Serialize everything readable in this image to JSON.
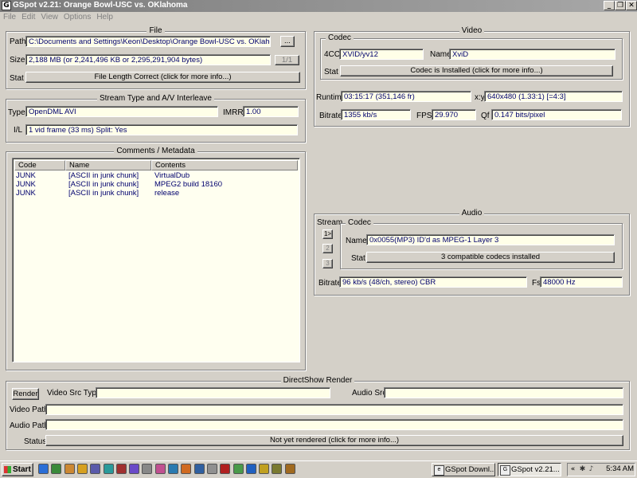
{
  "window": {
    "title": "GSpot v2.21: Orange Bowl-USC vs. OKlahoma",
    "buttons": {
      "minimize": "_",
      "restore": "❐",
      "close": "✕"
    }
  },
  "menu": [
    "File",
    "Edit",
    "View",
    "Options",
    "Help"
  ],
  "file": {
    "group_title": "File",
    "path_label": "Path",
    "path_value": "C:\\Documents and Settings\\Keon\\Desktop\\Orange Bowl-USC vs. OKlahoma.avi",
    "browse_label": "...",
    "size_label": "Size",
    "size_value": "2,188 MB (or 2,241,496 KB or 2,295,291,904 bytes)",
    "page_label": "1/1",
    "stat_label": "Stat",
    "stat_value": "File Length Correct (click for more info...)"
  },
  "stream": {
    "group_title": "Stream Type and A/V Interleave",
    "type_label": "Type",
    "type_value": "OpenDML AVI",
    "imrr_label": "IMRR",
    "imrr_value": "1.00",
    "il_label": "I/L",
    "il_value": "1 vid frame (33 ms)  Split: Yes"
  },
  "meta": {
    "group_title": "Comments / Metadata",
    "columns": [
      "Code",
      "Name",
      "Contents"
    ],
    "rows": [
      {
        "code": "JUNK",
        "name": "[ASCII in junk chunk]",
        "contents": "VirtualDub"
      },
      {
        "code": "JUNK",
        "name": "[ASCII in junk chunk]",
        "contents": "MPEG2 build 18160"
      },
      {
        "code": "JUNK",
        "name": "[ASCII in junk chunk]",
        "contents": "release"
      }
    ]
  },
  "video": {
    "group_title": "Video",
    "codec_title": "Codec",
    "fourcc_label": "4CC",
    "fourcc_value": "XVID/yv12",
    "name_label": "Name",
    "name_value": "XviD",
    "stat_label": "Stat",
    "stat_value": "Codec is Installed (click for more info...)",
    "runtime_label": "Runtime",
    "runtime_value": "03:15:17 (351,146 fr)",
    "xy_label": "x:y",
    "xy_value": "640x480 (1.33:1) [=4:3]",
    "bitrate_label": "Bitrate",
    "bitrate_value": "1355 kb/s",
    "fps_label": "FPS",
    "fps_value": "29.970",
    "qf_label": "Qf",
    "qf_value": "0.147 bits/pixel"
  },
  "audio": {
    "group_title": "Audio",
    "stream_label": "Stream",
    "stream_buttons": [
      "1>",
      "2",
      "3"
    ],
    "codec_title": "Codec",
    "name_label": "Name",
    "name_value": "0x0055(MP3) ID'd as MPEG-1 Layer 3",
    "stat_label": "Stat",
    "stat_value": "3 compatible codecs installed",
    "bitrate_label": "Bitrate",
    "bitrate_value": "96 kb/s (48/ch, stereo) CBR",
    "fs_label": "Fs",
    "fs_value": "48000 Hz"
  },
  "render": {
    "group_title": "DirectShow Render",
    "render_button": "Render",
    "video_src_type_label": "Video Src Type",
    "video_src_type_value": "",
    "audio_src_label": "Audio Src",
    "audio_src_value": "",
    "video_path_label": "Video Path",
    "video_path_value": "",
    "audio_path_label": "Audio Path",
    "audio_path_value": "",
    "status_label": "Status",
    "status_value": "Not yet rendered (click for more info...)"
  },
  "taskbar": {
    "start_label": "Start",
    "quicklaunch_icons": [
      "ie-icon",
      "search-icon",
      "network-icon",
      "folder-icon",
      "media-icon",
      "msn-icon",
      "mail-icon",
      "photo-icon",
      "files-icon",
      "chat-icon",
      "web-icon",
      "app-icon",
      "player-icon",
      "disk-icon",
      "flash-icon",
      "music-icon",
      "docs-icon",
      "star-icon",
      "note-icon",
      "pen-icon"
    ],
    "tasks": [
      {
        "label": "GSpot Downl...",
        "active": false
      },
      {
        "label": "GSpot v2.21...",
        "active": true
      }
    ],
    "tray_arrow": "«",
    "clock": "5:34 AM"
  }
}
